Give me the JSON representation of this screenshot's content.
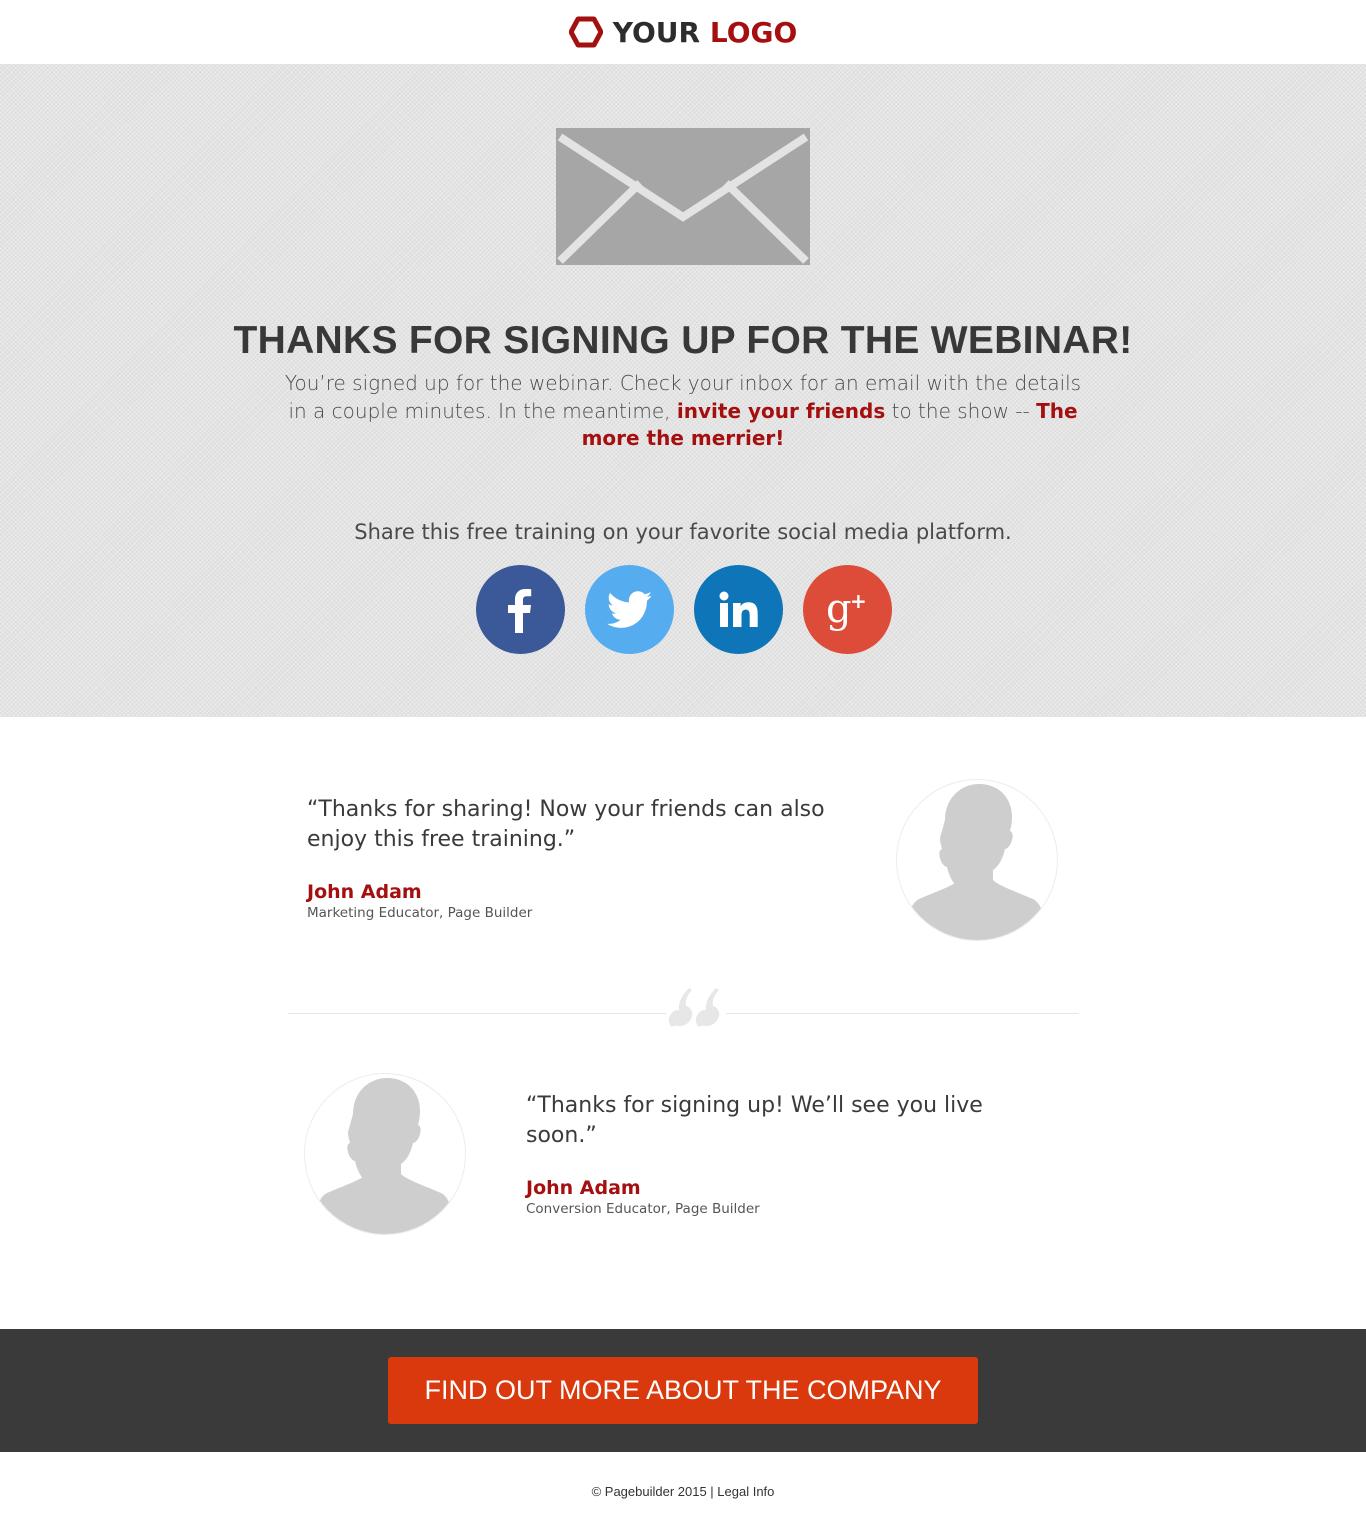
{
  "header": {
    "logo_part1": "YOUR ",
    "logo_part2": "LOGO",
    "accent_color": "#a50f0f"
  },
  "hero": {
    "icon": "envelope-icon",
    "title": "THANKS FOR SIGNING UP FOR THE WEBINAR!",
    "body_1": "You’re signed up for the webinar. Check your inbox for an email with the details in a couple minutes. In the meantime, ",
    "body_link": "invite your friends",
    "body_2": " to the show -- ",
    "body_emphasis": "The more the merrier!",
    "share_text": "Share this free training on your favorite social media platform.",
    "socials": [
      {
        "icon": "facebook-icon",
        "color": "#3b5998"
      },
      {
        "icon": "twitter-icon",
        "color": "#55acee"
      },
      {
        "icon": "linkedin-icon",
        "color": "#0e76b8"
      },
      {
        "icon": "google-plus-icon",
        "color": "#dd4b39"
      }
    ]
  },
  "testimonials": [
    {
      "quote": "“Thanks for sharing! Now your friends can also enjoy this free training.”",
      "name": "John Adam",
      "role": "Marketing Educator, Page Builder"
    },
    {
      "quote": "“Thanks for signing up! We’ll see you live soon.”",
      "name": "John Adam",
      "role": "Conversion Educator, Page Builder"
    }
  ],
  "cta": {
    "label": "FIND OUT MORE ABOUT THE COMPANY",
    "color": "#d9390c"
  },
  "footer": {
    "copyright": "© Pagebuilder 2015 | ",
    "legal": "Legal Info"
  }
}
